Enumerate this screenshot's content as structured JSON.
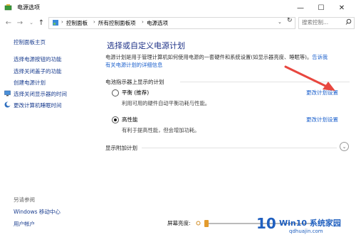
{
  "window": {
    "title": "电源选项",
    "minimize": "—",
    "maximize": "☐",
    "close": "✕"
  },
  "address": {
    "back": "←",
    "forward": "→",
    "up": "↑",
    "crumbs": [
      "控制面板",
      "所有控制面板项",
      "电源选项"
    ],
    "refresh": "↻",
    "search_placeholder": "搜索控制..."
  },
  "sidebar": {
    "items": [
      {
        "label": "控制面板主页"
      },
      {
        "label": "选择电源按钮的功能"
      },
      {
        "label": "选择关闭盖子的功能"
      },
      {
        "label": "创建电源计划"
      },
      {
        "label": "选择关闭显示器的时间"
      },
      {
        "label": "更改计算机睡眠时间"
      }
    ],
    "see_also": "另请参阅",
    "see_also_items": [
      {
        "label": "Windows 移动中心"
      },
      {
        "label": "用户帐户"
      }
    ]
  },
  "main": {
    "title": "选择或自定义电源计划",
    "desc_line1": "电源计划是用于管理计算机如何使用电源的一套硬件和系统设置(如显示器亮度、睡眠等)。",
    "desc_link1": "告诉我",
    "desc_link2": "有关电源计划的详细信息",
    "battery_group": "电池指示器上显示的计划",
    "plans": [
      {
        "name": "平衡 (推荐)",
        "desc": "利用可用的硬件自动平衡功耗与性能。",
        "change": "更改计划设置",
        "selected": false
      },
      {
        "name": "高性能",
        "desc": "有利于提高性能，但会增加功耗。",
        "change": "更改计划设置",
        "selected": true
      }
    ],
    "additional": "显示附加计划",
    "expand": "⌄",
    "brightness_label": "屏幕亮度:"
  },
  "watermark": {
    "num": "10",
    "brand": "Win10 系统家园",
    "url": "qdhuajin.com"
  },
  "colors": {
    "link": "#1a5fcc",
    "title": "#1e3287",
    "arrow": "#e8473f"
  }
}
